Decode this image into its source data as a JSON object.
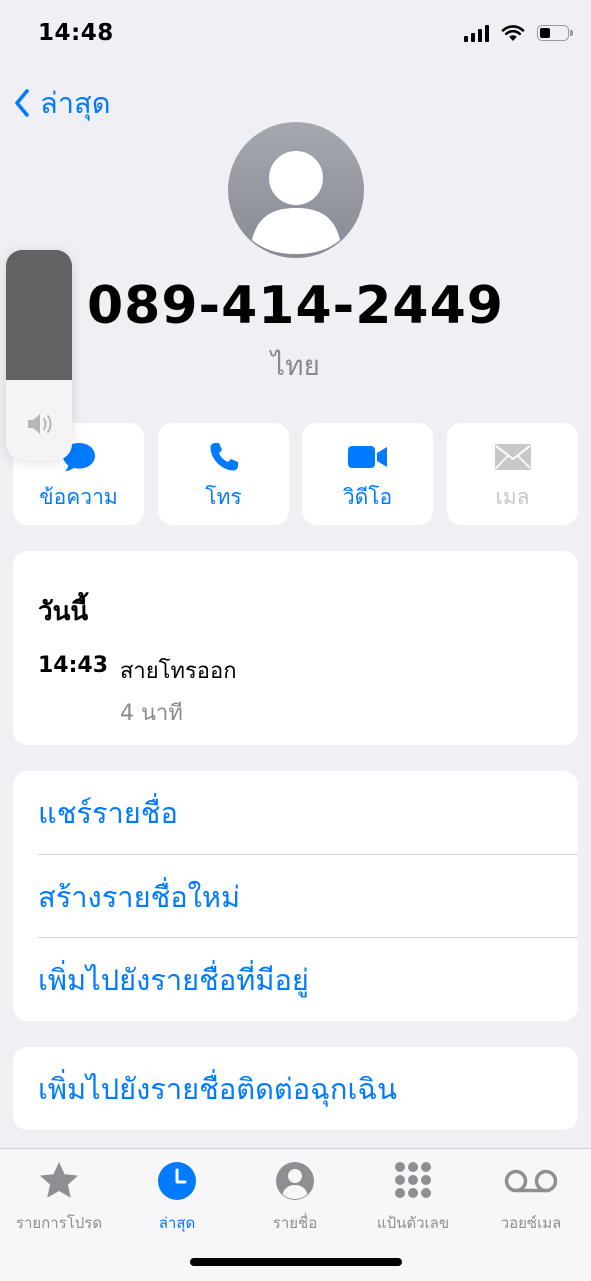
{
  "status": {
    "time": "14:48"
  },
  "nav": {
    "back_label": "ล่าสุด"
  },
  "contact": {
    "number": "089-414-2449",
    "label": "ไทย"
  },
  "volume": {
    "level": 0.62
  },
  "actions": [
    {
      "label": "ข้อความ",
      "icon": "message-bubble-icon",
      "enabled": true
    },
    {
      "label": "โทร",
      "icon": "phone-icon",
      "enabled": true
    },
    {
      "label": "วิดีโอ",
      "icon": "video-camera-icon",
      "enabled": true
    },
    {
      "label": "เมล",
      "icon": "mail-icon",
      "enabled": false
    }
  ],
  "recents": {
    "title": "วันนี้",
    "entries": [
      {
        "time": "14:43",
        "type": "สายโทรออก",
        "duration": "4 นาที"
      }
    ]
  },
  "options": [
    "แชร์รายชื่อ",
    "สร้างรายชื่อใหม่",
    "เพิ่มไปยังรายชื่อที่มีอยู่"
  ],
  "emergency": {
    "label": "เพิ่มไปยังรายชื่อติดต่อฉุกเฉิน"
  },
  "tabs": [
    {
      "label": "รายการโปรด",
      "icon": "star-icon",
      "active": false
    },
    {
      "label": "ล่าสุด",
      "icon": "clock-icon",
      "active": true
    },
    {
      "label": "รายชื่อ",
      "icon": "person-circle-icon",
      "active": false
    },
    {
      "label": "แป้นตัวเลข",
      "icon": "keypad-icon",
      "active": false
    },
    {
      "label": "วอยซ์เมล",
      "icon": "voicemail-icon",
      "active": false
    }
  ],
  "colors": {
    "accent": "#007aff",
    "background": "#efeff4",
    "secondary_text": "#8a8a8e",
    "disabled": "#c7c7cc"
  }
}
